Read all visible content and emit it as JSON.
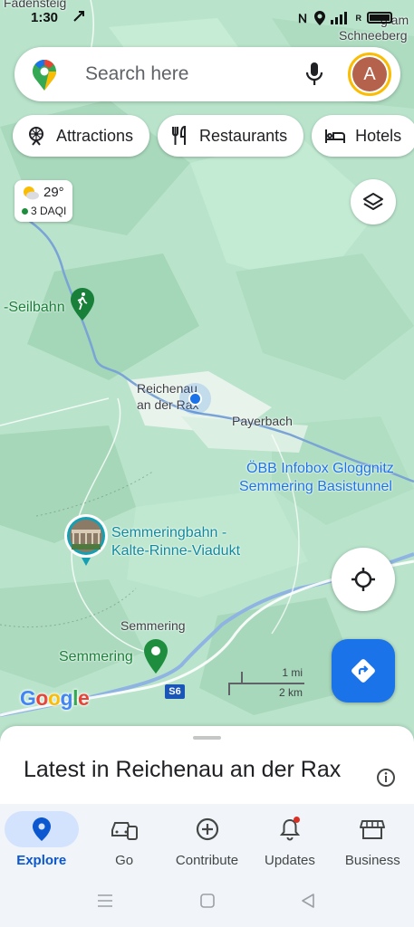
{
  "status_bar": {
    "time": "1:30",
    "signal_text": "R",
    "network_text": ""
  },
  "search": {
    "placeholder": "Search here",
    "avatar_letter": "A"
  },
  "chips": [
    {
      "label": "Attractions",
      "icon": "ferris-wheel-icon"
    },
    {
      "label": "Restaurants",
      "icon": "fork-knife-icon"
    },
    {
      "label": "Hotels",
      "icon": "bed-icon"
    }
  ],
  "weather": {
    "temperature": "29°",
    "aqi": "3 DAQI",
    "aqi_color": "#1e8e3e"
  },
  "map_labels": {
    "fadensteig": "Fadensteig",
    "schneeberg_line1": "g am",
    "schneeberg_line2": "Schneeberg",
    "seilbahn": "-Seilbahn",
    "reichenau_line1": "Reichenau",
    "reichenau_line2": "an der Rax",
    "payerbach": "Payerbach",
    "oebb_line1": "ÖBB Infobox Gloggnitz",
    "oebb_line2": "Semmering Basistunnel",
    "viaduct_line1": "Semmeringbahn -",
    "viaduct_line2": "Kalte-Rinne-Viadukt",
    "semmering_town": "Semmering",
    "semmering_poi": "Semmering",
    "road_badge": "S6"
  },
  "scale": {
    "imperial": "1 mi",
    "metric": "2 km"
  },
  "logo": {
    "g1": "G",
    "o1": "o",
    "o2": "o",
    "g2": "g",
    "l": "l",
    "e": "e"
  },
  "sheet": {
    "title": "Latest in Reichenau an der Rax"
  },
  "bottom_nav": [
    {
      "label": "Explore",
      "icon": "pin-icon",
      "active": true
    },
    {
      "label": "Go",
      "icon": "car-icon",
      "active": false
    },
    {
      "label": "Contribute",
      "icon": "add-circle-icon",
      "active": false
    },
    {
      "label": "Updates",
      "icon": "bell-icon",
      "active": false
    },
    {
      "label": "Business",
      "icon": "storefront-icon",
      "active": false
    }
  ],
  "colors": {
    "accent": "#1a73e8",
    "map_green": "#b9e4cb",
    "poi_green": "#188038"
  }
}
